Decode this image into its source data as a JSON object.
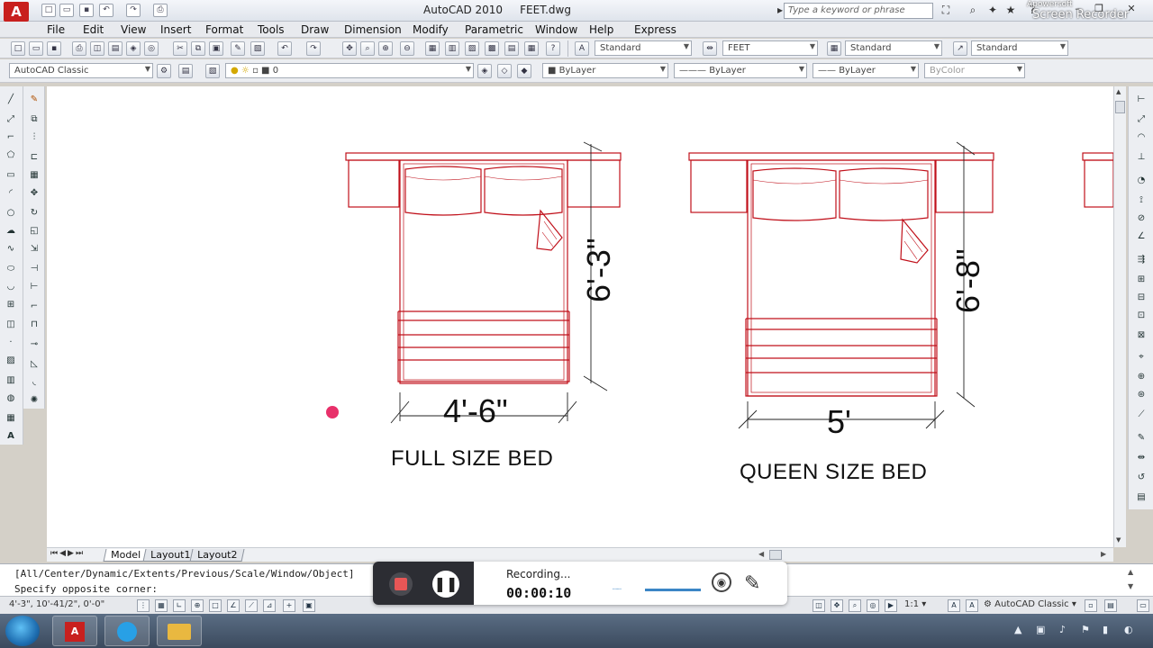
{
  "window": {
    "app_title": "AutoCAD 2010",
    "file_name": "FEET.dwg",
    "search_placeholder": "Type a keyword or phrase",
    "watermark_line1": "Apowersoft",
    "watermark_line2": "Screen Recorder"
  },
  "menu": [
    "File",
    "Edit",
    "View",
    "Insert",
    "Format",
    "Tools",
    "Draw",
    "Dimension",
    "Modify",
    "Parametric",
    "Window",
    "Help",
    "Express"
  ],
  "styles_toolbar": {
    "text_style": "Standard",
    "dim_style": "FEET",
    "table_style": "Standard",
    "multileader_style": "Standard"
  },
  "layers_toolbar": {
    "workspace": "AutoCAD Classic",
    "layer": "0",
    "color": "ByLayer",
    "linetype": "ByLayer",
    "lineweight": "ByLayer",
    "plotstyle": "ByColor"
  },
  "drawing": {
    "full_bed": {
      "width_dim": "4'-6\"",
      "length_dim": "6'-3\"",
      "label": "FULL SIZE BED"
    },
    "queen_bed": {
      "width_dim": "5'",
      "length_dim": "6'-8\"",
      "label": "QUEEN SIZE BED"
    }
  },
  "layout_tabs": [
    "Model",
    "Layout1",
    "Layout2"
  ],
  "command": {
    "line1": "[All/Center/Dynamic/Extents/Previous/Scale/Window/Object]",
    "line2": "Specify opposite corner:"
  },
  "status": {
    "coordinates": "4'-3\", 10'-41/2\", 0'-0\"",
    "annotation_scale": "1:1",
    "workspace": "AutoCAD Classic"
  },
  "recorder": {
    "status": "Recording...",
    "timer": "00:00:10",
    "volume_level": 0.75
  },
  "colors": {
    "drawing_red": "#c0101a",
    "accent_red": "#e85656",
    "canvas_bg": "#ffffff"
  }
}
